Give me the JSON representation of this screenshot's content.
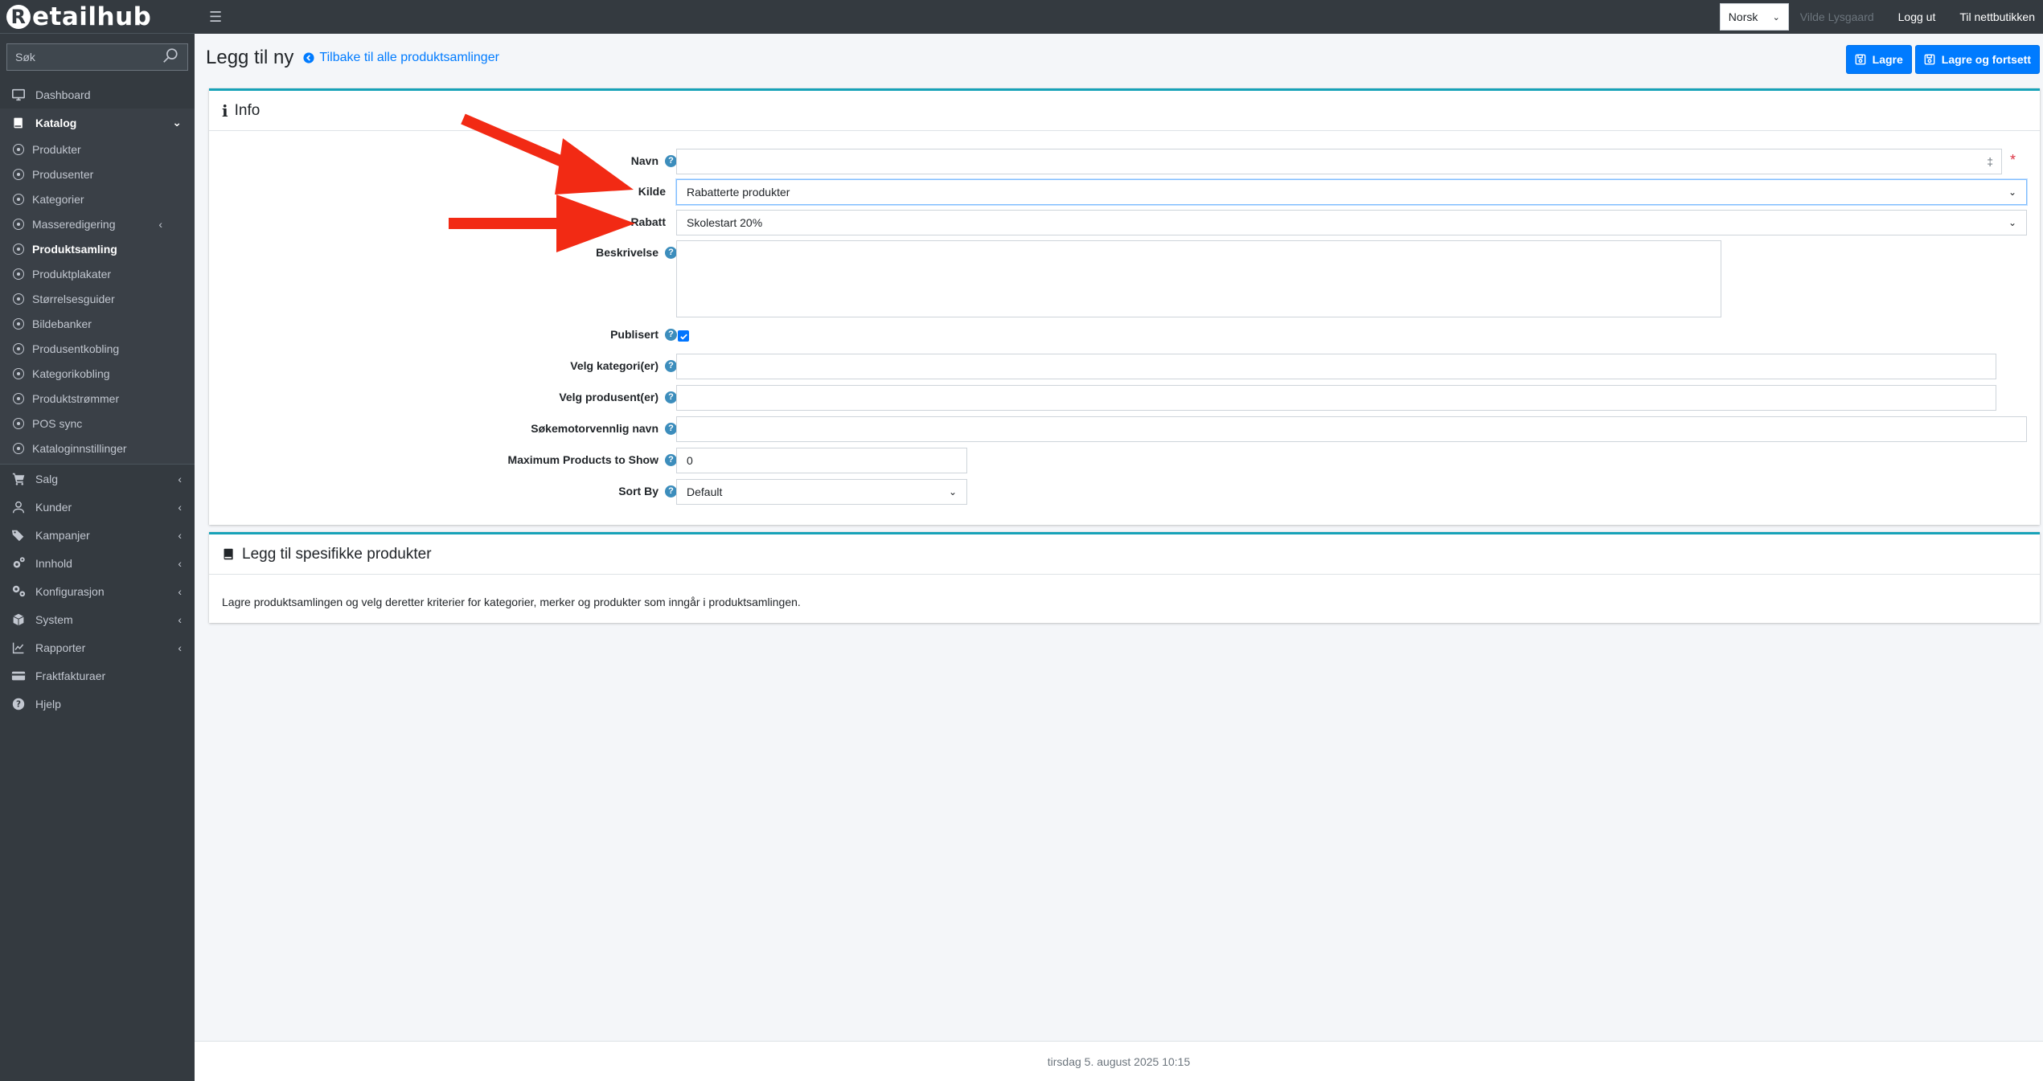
{
  "brand": {
    "logo_text": "etailhub",
    "logo_letter": "R"
  },
  "sidebar": {
    "search_placeholder": "Søk",
    "top_items": [
      {
        "label": "Dashboard"
      }
    ],
    "katalog": {
      "label": "Katalog"
    },
    "katalog_items": [
      {
        "label": "Produkter"
      },
      {
        "label": "Produsenter"
      },
      {
        "label": "Kategorier"
      },
      {
        "label": "Masseredigering"
      },
      {
        "label": "Produktsamling"
      },
      {
        "label": "Produktplakater"
      },
      {
        "label": "Størrelsesguider"
      },
      {
        "label": "Bildebanker"
      },
      {
        "label": "Produsentkobling"
      },
      {
        "label": "Kategorikobling"
      },
      {
        "label": "Produktstrømmer"
      },
      {
        "label": "POS sync"
      },
      {
        "label": "Kataloginnstillinger"
      }
    ],
    "bottom_items": [
      {
        "label": "Salg"
      },
      {
        "label": "Kunder"
      },
      {
        "label": "Kampanjer"
      },
      {
        "label": "Innhold"
      },
      {
        "label": "Konfigurasjon"
      },
      {
        "label": "System"
      },
      {
        "label": "Rapporter"
      },
      {
        "label": "Fraktfakturaer"
      },
      {
        "label": "Hjelp"
      }
    ]
  },
  "topbar": {
    "language": "Norsk",
    "user": "Vilde Lysgaard",
    "logout": "Logg ut",
    "store": "Til nettbutikken"
  },
  "header": {
    "title": "Legg til ny",
    "back_link": "Tilbake til alle produktsamlinger",
    "save": "Lagre",
    "save_continue": "Lagre og fortsett"
  },
  "info_card": {
    "title": "Info",
    "fields": {
      "navn": {
        "label": "Navn",
        "value": ""
      },
      "kilde": {
        "label": "Kilde",
        "value": "Rabatterte produkter"
      },
      "rabatt": {
        "label": "Rabatt",
        "value": "Skolestart 20%"
      },
      "beskrivelse": {
        "label": "Beskrivelse",
        "value": ""
      },
      "publisert": {
        "label": "Publisert",
        "checked": true
      },
      "kategori": {
        "label": "Velg kategori(er)",
        "value": ""
      },
      "produsent": {
        "label": "Velg produsent(er)",
        "value": ""
      },
      "seo": {
        "label": "Søkemotorvennlig navn",
        "value": ""
      },
      "max_products": {
        "label": "Maximum Products to Show",
        "value": "0"
      },
      "sort_by": {
        "label": "Sort By",
        "value": "Default"
      }
    }
  },
  "products_card": {
    "title": "Legg til spesifikke produkter",
    "description": "Lagre produktsamlingen og velg deretter kriterier for kategorier, merker og produkter som inngår i produktsamlingen."
  },
  "footer": {
    "timestamp": "tirsdag 5. august 2025 10:15"
  },
  "colors": {
    "accent": "#007bff",
    "card_top": "#17a2b8",
    "sidebar": "#343a40",
    "arrow": "#f22a14"
  }
}
